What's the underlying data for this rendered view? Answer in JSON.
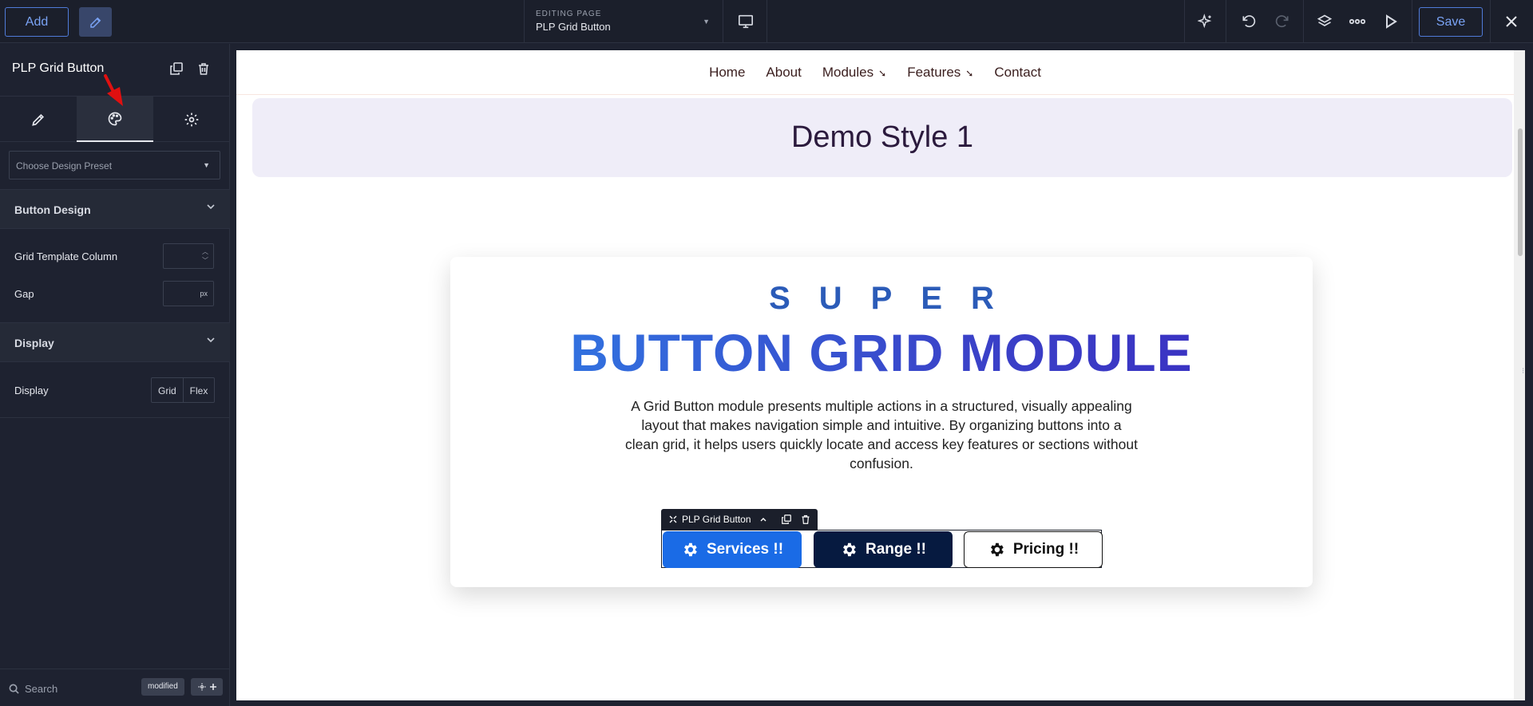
{
  "topbar": {
    "add_label": "Add",
    "editing_label": "EDITING PAGE",
    "page_name": "PLP Grid Button",
    "save_label": "Save"
  },
  "sidebar": {
    "element_title": "PLP Grid Button",
    "preset_placeholder": "Choose Design Preset",
    "sections": {
      "button_design": "Button Design",
      "display": "Display"
    },
    "fields": {
      "grid_template_column": "Grid Template Column",
      "gap": "Gap",
      "gap_unit": "px",
      "display": "Display",
      "display_options": [
        "Grid",
        "Flex"
      ]
    },
    "search_label": "Search",
    "modified_badge": "modified"
  },
  "canvas": {
    "nav": [
      "Home",
      "About",
      "Modules",
      "Features",
      "Contact"
    ],
    "nav_arrow": "➘",
    "demo_title": "Demo Style 1",
    "super_text": "SUPER",
    "main_title": "BUTTON GRID MODULE",
    "description": "A Grid Button module presents multiple actions in a structured, visually appealing layout that makes navigation simple and intuitive. By organizing buttons into a clean grid, it helps users quickly locate and access key features or sections without confusion.",
    "module_tag": "PLP Grid Button",
    "buttons": [
      "Services !!",
      "Range !!",
      "Pricing !!"
    ]
  },
  "colors": {
    "accent": "#4f7bd9",
    "services_btn": "#1a6be6",
    "range_btn": "#061a40",
    "annotation_arrow": "#e01010"
  }
}
